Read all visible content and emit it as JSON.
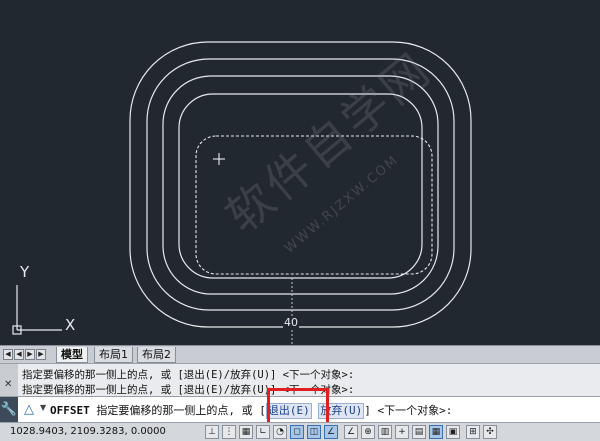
{
  "drawing": {
    "ucs_x_label": "X",
    "ucs_y_label": "Y",
    "dimension_value": "40"
  },
  "watermark": {
    "text_cn": "软件自学网",
    "text_url": "WWW.RJZXW.COM"
  },
  "tabs": [
    {
      "label": "模型",
      "active": true
    },
    {
      "label": "布局1",
      "active": false
    },
    {
      "label": "布局2",
      "active": false
    }
  ],
  "command_history": [
    "指定要偏移的那一侧上的点, 或 [退出(E)/放弃(U)] <下一个对象>:",
    "指定要偏移的那一侧上的点, 或 [退出(E)/放弃(U)] <下一个对象>:"
  ],
  "command_line": {
    "command": "OFFSET",
    "prompt": "指定要偏移的那一侧上的点, 或",
    "open_bracket": "[",
    "option_exit": "退出(E)",
    "option_undo": "放弃(U)",
    "close_bracket": "]",
    "default": "<下一个对象>:"
  },
  "status": {
    "coordinates": "1028.9403, 2109.3283, 0.0000"
  },
  "colors": {
    "canvas": "#212830",
    "geometry": "#e8eaec",
    "highlight": "#e02020"
  }
}
